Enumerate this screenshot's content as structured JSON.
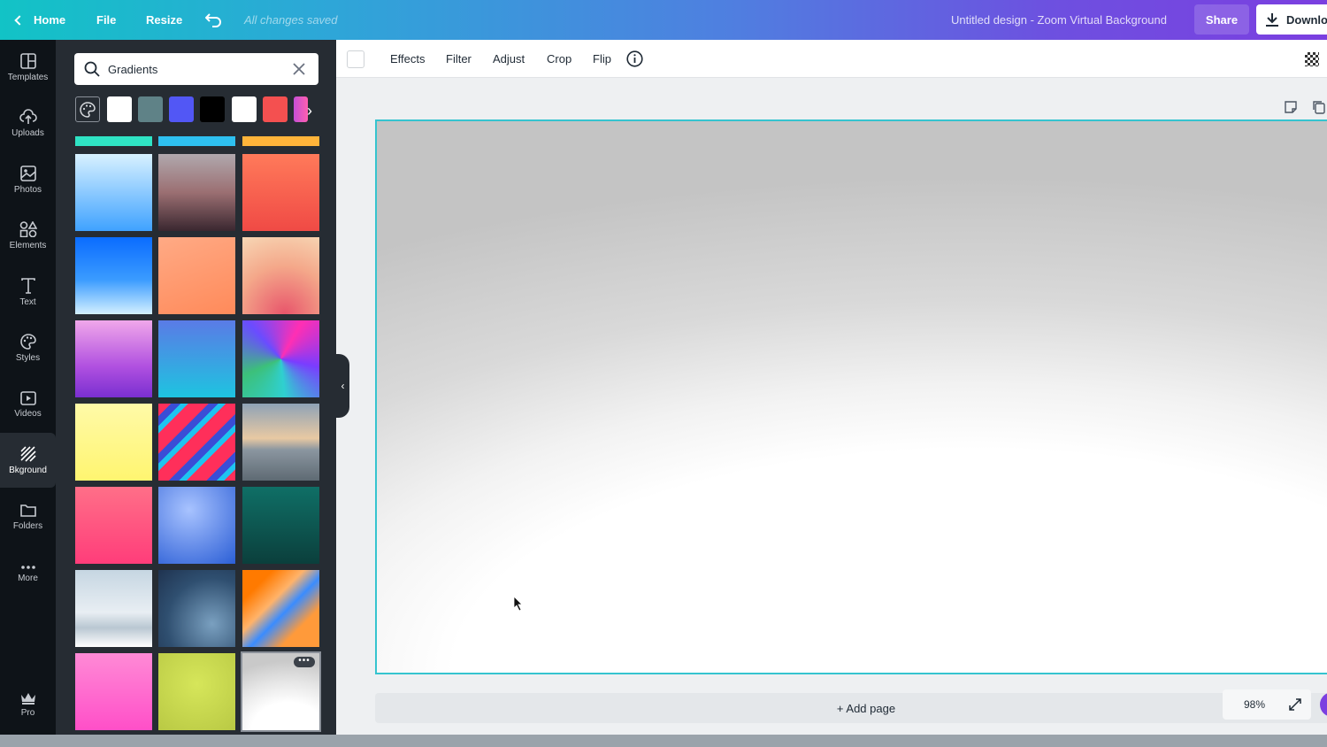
{
  "topbar": {
    "home": "Home",
    "file": "File",
    "resize": "Resize",
    "saved_status": "All changes saved",
    "title": "Untitled design - Zoom Virtual Background",
    "share": "Share",
    "download": "Downlo"
  },
  "rail": {
    "items": [
      {
        "label": "Templates",
        "icon": "templates-icon"
      },
      {
        "label": "Uploads",
        "icon": "upload-cloud-icon"
      },
      {
        "label": "Photos",
        "icon": "photo-icon"
      },
      {
        "label": "Elements",
        "icon": "shapes-icon"
      },
      {
        "label": "Text",
        "icon": "text-icon"
      },
      {
        "label": "Styles",
        "icon": "palette-icon"
      },
      {
        "label": "Videos",
        "icon": "video-icon"
      },
      {
        "label": "Bkground",
        "icon": "background-stripes-icon"
      },
      {
        "label": "Folders",
        "icon": "folder-icon"
      },
      {
        "label": "More",
        "icon": "more-dots-icon"
      }
    ],
    "pro": "Pro"
  },
  "panel": {
    "search_value": "Gradients",
    "swatch_colors": [
      "#ffffff",
      "#5f8287",
      "#5257f5",
      "#000000",
      "#ffffff",
      "#f45050"
    ]
  },
  "toolbar": {
    "effects": "Effects",
    "filter": "Filter",
    "adjust": "Adjust",
    "crop": "Crop",
    "flip": "Flip"
  },
  "canvas": {
    "add_page": "+ Add page",
    "zoom": "98%"
  },
  "colors": {
    "selection_border": "#35c4cf",
    "sidebar": "#0e1318",
    "panel": "#262c33"
  }
}
